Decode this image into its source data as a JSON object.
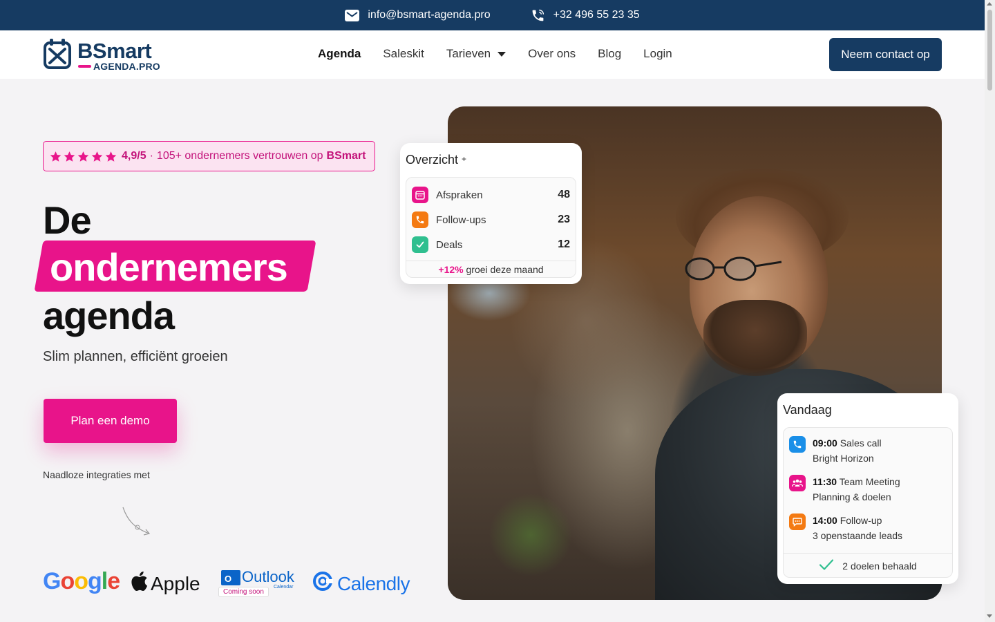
{
  "topbar": {
    "email": "info@bsmart-agenda.pro",
    "phone": "+32 496 55 23 35",
    "email_icon": "mail-icon",
    "phone_icon": "phone-icon"
  },
  "brand": {
    "name": "BSmart",
    "sub": "AGENDA.PRO",
    "icon": "calendar-icon"
  },
  "nav": {
    "items": [
      {
        "label": "Agenda",
        "active": true
      },
      {
        "label": "Saleskit"
      },
      {
        "label": "Tarieven",
        "dropdown": true
      },
      {
        "label": "Over ons"
      },
      {
        "label": "Blog"
      },
      {
        "label": "Login"
      }
    ],
    "cta": "Neem contact op"
  },
  "hero": {
    "rating": {
      "stars": 5,
      "score": "4,9/5",
      "separator": "·",
      "text": "105+ ondernemers vertrouwen op",
      "brand": "BSmart"
    },
    "heading": {
      "line1": "De",
      "highlight": "ondernemers",
      "line3": "agenda"
    },
    "subtitle": "Slim plannen, efficiënt groeien",
    "demo_button": "Plan een demo",
    "integrations_label": "Naadloze integraties met",
    "integrations": {
      "google": "Google",
      "apple": "Apple",
      "outlook": "Outlook",
      "outlook_sub": "Calendar",
      "outlook_badge": "Coming soon",
      "calendly": "Calendly"
    }
  },
  "overview": {
    "title": "Overzicht",
    "title_suffix": "+",
    "rows": [
      {
        "label": "Afspraken",
        "value": "48",
        "icon": "calendar-icon",
        "color": "#e8148a"
      },
      {
        "label": "Follow-ups",
        "value": "23",
        "icon": "phone-icon",
        "color": "#f47a12"
      },
      {
        "label": "Deals",
        "value": "12",
        "icon": "check-icon",
        "color": "#2fbf8f"
      }
    ],
    "growth_pct": "+12%",
    "growth_text": "groei deze maand"
  },
  "today": {
    "title": "Vandaag",
    "items": [
      {
        "time": "09:00",
        "title": "Sales call",
        "detail": "Bright Horizon",
        "icon": "phone-icon",
        "color": "#1a8fe8"
      },
      {
        "time": "11:30",
        "title": "Team Meeting",
        "detail": "Planning & doelen",
        "icon": "team-icon",
        "color": "#e8148a"
      },
      {
        "time": "14:00",
        "title": "Follow-up",
        "detail": "3 openstaande leads",
        "icon": "chat-icon",
        "color": "#f47a12"
      }
    ],
    "footer": "2 doelen behaald"
  },
  "colors": {
    "navy": "#163b62",
    "pink": "#e8148a",
    "background": "#f4f3f5"
  }
}
